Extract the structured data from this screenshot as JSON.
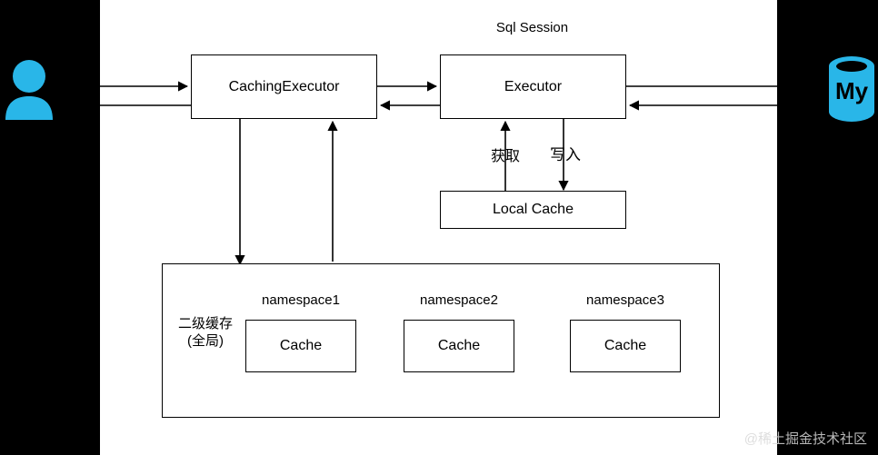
{
  "diagram": {
    "title": "Sql Session",
    "watermark": "@稀土掘金技术社区",
    "colors": {
      "accent": "#29b6e8",
      "stroke": "#000000",
      "canvas": "#ffffff",
      "background": "#000000"
    },
    "actors": {
      "user_icon": "user-icon",
      "database_icon": "mysql-database-icon",
      "database_label": "My"
    },
    "nodes": {
      "caching_executor": "CachingExecutor",
      "executor": "Executor",
      "local_cache": "Local Cache",
      "second_level_cache_label_line1": "二级缓存",
      "second_level_cache_label_line2": "(全局)"
    },
    "edge_labels": {
      "fetch": "获取",
      "write": "写入"
    },
    "namespaces": [
      {
        "name": "namespace1",
        "cache_label": "Cache"
      },
      {
        "name": "namespace2",
        "cache_label": "Cache"
      },
      {
        "name": "namespace3",
        "cache_label": "Cache"
      }
    ]
  }
}
